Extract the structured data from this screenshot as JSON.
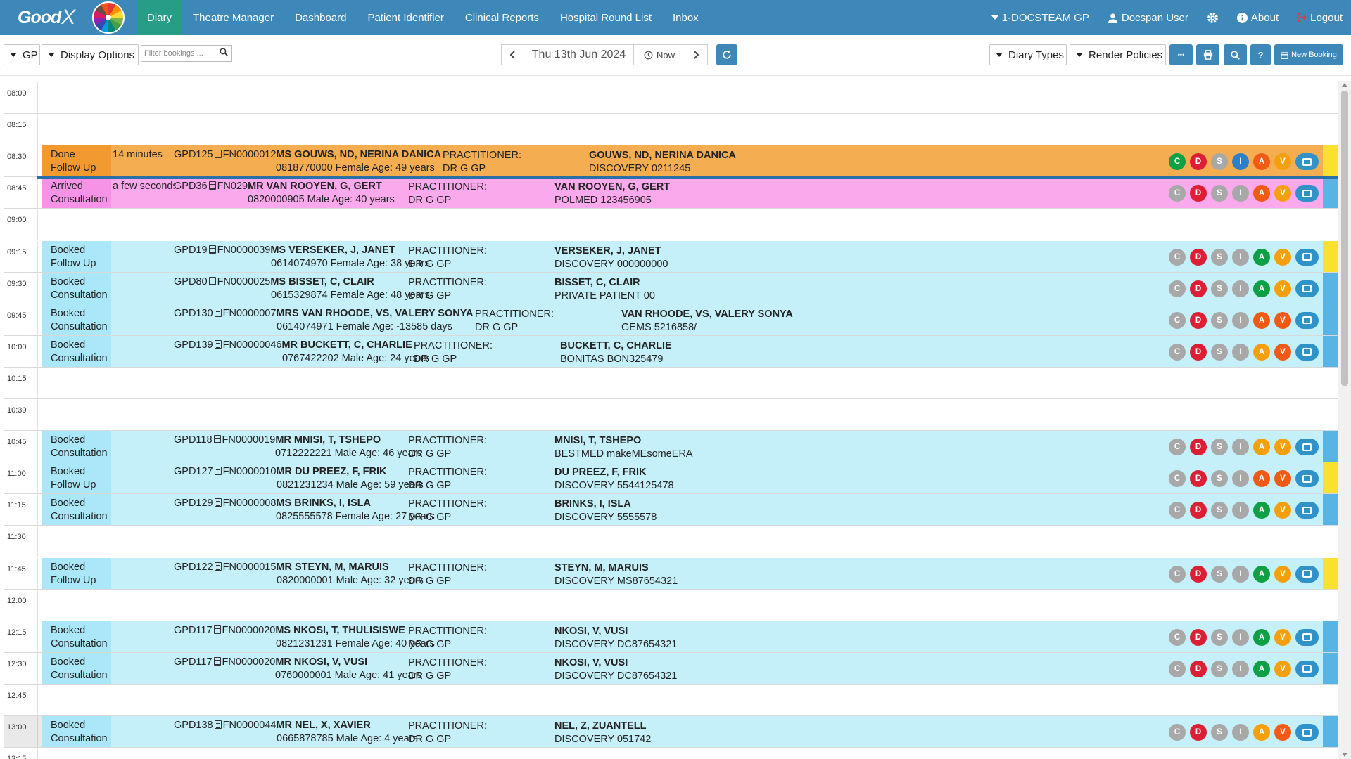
{
  "brand": {
    "logo_text": "Good",
    "logo_x": "X"
  },
  "nav": {
    "tabs": [
      "Diary",
      "Theatre Manager",
      "Dashboard",
      "Patient Identifier",
      "Clinical Reports",
      "Hospital Round List",
      "Inbox"
    ],
    "active_tab": "Diary",
    "practice": "1-DOCSTEAM GP",
    "user": "Docspan User",
    "about": "About",
    "logout": "Logout"
  },
  "toolbar": {
    "gp_label": "GP",
    "display_options": "Display Options",
    "filter_placeholder": "Filter bookings ...",
    "date": "Thu 13th Jun 2024",
    "now_label": "Now",
    "diary_types": "Diary Types",
    "render_policies": "Render Policies",
    "more_label": "•••",
    "new_booking": "New Booking"
  },
  "colors": {
    "nav_bg": "#3d88b8",
    "active_tab_bg": "#279c87",
    "booked_bg": "#c6f0f9",
    "done_bg": "#f5ad51",
    "arrived_bg": "#f9a9ec",
    "edge_yellow": "#fae12e",
    "edge_blue": "#59b4e6"
  },
  "times": [
    "08:00",
    "08:15",
    "08:30",
    "08:45",
    "09:00",
    "09:15",
    "09:30",
    "09:45",
    "10:00",
    "10:15",
    "10:30",
    "10:45",
    "11:00",
    "11:15",
    "11:30",
    "11:45",
    "12:00",
    "12:15",
    "12:30",
    "12:45",
    "13:00",
    "13:15"
  ],
  "bookings": [
    {
      "slot": "08:30",
      "variant": "orange",
      "edge": "yellow",
      "status": "Done",
      "type": "Follow Up",
      "time_ago": "14 minutes",
      "ids": "GPD125",
      "file": "FN0000012",
      "patient": "MS GOUWS, ND, NERINA DANICA",
      "phone_line": "0818770000 Female Age: 49 years",
      "prac_label": "PRACTITIONER:",
      "prac": "DR G GP",
      "bill_name": "GOUWS, ND, NERINA DANICA",
      "medical_aid": "DISCOVERY 0211245",
      "badges": [
        "green",
        "red",
        "grey",
        "blue",
        "orangered",
        "orange"
      ]
    },
    {
      "slot": "08:45",
      "variant": "pink",
      "edge": "blue",
      "status": "Arrived",
      "type": "Consultation",
      "time_ago": "a few seconds ago",
      "ids": "GPD36",
      "file": "FN029",
      "patient": "MR VAN ROOYEN, G, GERT",
      "phone_line": "0820000905 Male Age: 40 years",
      "prac_label": "PRACTITIONER:",
      "prac": "DR G GP",
      "bill_name": "VAN ROOYEN, G, GERT",
      "medical_aid": "POLMED 123456905",
      "badges": [
        "grey",
        "red",
        "grey",
        "grey",
        "orangered",
        "orange"
      ]
    },
    {
      "slot": "09:15",
      "variant": "cyan",
      "edge": "yellow",
      "status": "Booked",
      "type": "Follow Up",
      "time_ago": "",
      "ids": "GPD19",
      "file": "FN0000039",
      "patient": "MS VERSEKER, J, JANET",
      "phone_line": "0614074970 Female Age: 38 years",
      "prac_label": "PRACTITIONER:",
      "prac": "DR G GP",
      "bill_name": "VERSEKER, J, JANET",
      "medical_aid": "DISCOVERY 000000000",
      "badges": [
        "grey",
        "red",
        "grey",
        "grey",
        "green",
        "orange"
      ]
    },
    {
      "slot": "09:30",
      "variant": "cyan",
      "edge": "blue",
      "status": "Booked",
      "type": "Consultation",
      "time_ago": "",
      "ids": "GPD80",
      "file": "FN0000025",
      "patient": "MS BISSET, C, CLAIR",
      "phone_line": "0615329874 Female Age: 48 years",
      "prac_label": "PRACTITIONER:",
      "prac": "DR G GP",
      "bill_name": "BISSET, C, CLAIR",
      "medical_aid": "PRIVATE PATIENT 00",
      "badges": [
        "grey",
        "red",
        "grey",
        "grey",
        "green",
        "orange"
      ]
    },
    {
      "slot": "09:45",
      "variant": "cyan",
      "edge": "blue",
      "status": "Booked",
      "type": "Consultation",
      "time_ago": "",
      "ids": "GPD130",
      "file": "FN0000007",
      "patient": "MRS VAN RHOODE, VS, VALERY SONYA",
      "phone_line": "0614074971 Female Age: -13585 days",
      "prac_label": "PRACTITIONER:",
      "prac": "DR G GP",
      "bill_name": "VAN RHOODE, VS, VALERY SONYA",
      "medical_aid": "GEMS 5216858/",
      "badges": [
        "grey",
        "red",
        "grey",
        "grey",
        "orangered",
        "orangered"
      ]
    },
    {
      "slot": "10:00",
      "variant": "cyan",
      "edge": "blue",
      "status": "Booked",
      "type": "Consultation",
      "time_ago": "",
      "ids": "GPD139",
      "file": "FN00000046",
      "patient": "MR BUCKETT, C, CHARLIE",
      "phone_line": "0767422202 Male Age: 24 years",
      "prac_label": "PRACTITIONER:",
      "prac": "DR G GP",
      "bill_name": "BUCKETT, C, CHARLIE",
      "medical_aid": "BONITAS BON325479",
      "badges": [
        "grey",
        "red",
        "grey",
        "grey",
        "orange",
        "orangered"
      ]
    },
    {
      "slot": "10:45",
      "variant": "cyan",
      "edge": "blue",
      "status": "Booked",
      "type": "Consultation",
      "time_ago": "",
      "ids": "GPD118",
      "file": "FN0000019",
      "patient": "MR MNISI, T, TSHEPO",
      "phone_line": "0712222221 Male Age: 46 years",
      "prac_label": "PRACTITIONER:",
      "prac": "DR G GP",
      "bill_name": "MNISI, T, TSHEPO",
      "medical_aid": "BESTMED makeMEsomeERA",
      "badges": [
        "grey",
        "red",
        "grey",
        "grey",
        "orange",
        "orange"
      ]
    },
    {
      "slot": "11:00",
      "variant": "cyan",
      "edge": "yellow",
      "status": "Booked",
      "type": "Follow Up",
      "time_ago": "",
      "ids": "GPD127",
      "file": "FN0000010",
      "patient": "MR DU PREEZ, F, FRIK",
      "phone_line": "0821231234 Male Age: 59 years",
      "prac_label": "PRACTITIONER:",
      "prac": "DR G GP",
      "bill_name": "DU PREEZ, F, FRIK",
      "medical_aid": "DISCOVERY 5544125478",
      "badges": [
        "grey",
        "red",
        "grey",
        "grey",
        "orangered",
        "orangered"
      ]
    },
    {
      "slot": "11:15",
      "variant": "cyan",
      "edge": "blue",
      "status": "Booked",
      "type": "Consultation",
      "time_ago": "",
      "ids": "GPD129",
      "file": "FN0000008",
      "patient": "MS BRINKS, I, ISLA",
      "phone_line": "0825555578 Female Age: 27 years",
      "prac_label": "PRACTITIONER:",
      "prac": "DR G GP",
      "bill_name": "BRINKS, I, ISLA",
      "medical_aid": "DISCOVERY 5555578",
      "badges": [
        "grey",
        "red",
        "grey",
        "grey",
        "green",
        "orange"
      ]
    },
    {
      "slot": "11:45",
      "variant": "cyan",
      "edge": "yellow",
      "status": "Booked",
      "type": "Follow Up",
      "time_ago": "",
      "ids": "GPD122",
      "file": "FN0000015",
      "patient": "MR STEYN, M, MARUIS",
      "phone_line": "0820000001 Male Age: 32 years",
      "prac_label": "PRACTITIONER:",
      "prac": "DR G GP",
      "bill_name": "STEYN, M, MARUIS",
      "medical_aid": "DISCOVERY MS87654321",
      "badges": [
        "grey",
        "red",
        "grey",
        "grey",
        "green",
        "orange"
      ]
    },
    {
      "slot": "12:15",
      "variant": "cyan",
      "edge": "blue",
      "status": "Booked",
      "type": "Consultation",
      "time_ago": "",
      "ids": "GPD117",
      "file": "FN0000020",
      "patient": "MS NKOSI, T, THULISISWE",
      "phone_line": "0821231231 Female Age: 40 years",
      "prac_label": "PRACTITIONER:",
      "prac": "DR G GP",
      "bill_name": "NKOSI, V, VUSI",
      "medical_aid": "DISCOVERY DC87654321",
      "badges": [
        "grey",
        "red",
        "grey",
        "grey",
        "green",
        "orange"
      ]
    },
    {
      "slot": "12:30",
      "variant": "cyan",
      "edge": "blue",
      "status": "Booked",
      "type": "Consultation",
      "time_ago": "",
      "ids": "GPD117",
      "file": "FN0000020",
      "patient": "MR NKOSI, V, VUSI",
      "phone_line": "0760000001 Male Age: 41 years",
      "prac_label": "PRACTITIONER:",
      "prac": "DR G GP",
      "bill_name": "NKOSI, V, VUSI",
      "medical_aid": "DISCOVERY DC87654321",
      "badges": [
        "grey",
        "red",
        "grey",
        "grey",
        "green",
        "orange"
      ]
    },
    {
      "slot": "13:00",
      "variant": "cyan",
      "edge": "blue",
      "status": "Booked",
      "type": "Consultation",
      "time_ago": "",
      "ids": "GPD138",
      "file": "FN0000044",
      "patient": "MR NEL, X, XAVIER",
      "phone_line": "0665878785 Male Age: 4 years",
      "prac_label": "PRACTITIONER:",
      "prac": "DR G GP",
      "bill_name": "NEL, Z, ZUANTELL",
      "medical_aid": "DISCOVERY 051742",
      "badges": [
        "grey",
        "red",
        "grey",
        "grey",
        "orange",
        "orangered"
      ]
    }
  ],
  "badge_letters": [
    "C",
    "D",
    "S",
    "I",
    "A",
    "V"
  ]
}
